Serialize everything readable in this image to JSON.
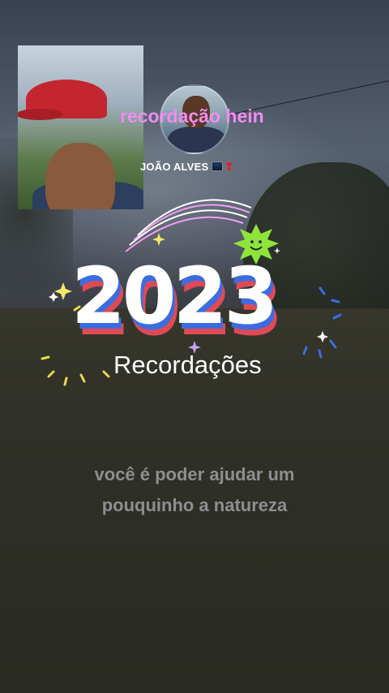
{
  "overlay": {
    "pink_caption": "recordação hein",
    "username": "JOÃO ALVES",
    "year": "2023",
    "subtitle": "Recordações",
    "caption_line1": "você é poder ajudar um",
    "caption_line2": "pouquinho a natureza"
  },
  "colors": {
    "pink_text": "#f08cf0",
    "year_red": "#e04a55",
    "year_blue": "#3a6ee0",
    "sun_green": "#8fe43c",
    "caption_gray": "#8e8e90"
  },
  "icons": [
    "night-city-emoji-icon",
    "heart-exclamation-icon",
    "smiling-sun-icon",
    "sparkle-icon"
  ]
}
